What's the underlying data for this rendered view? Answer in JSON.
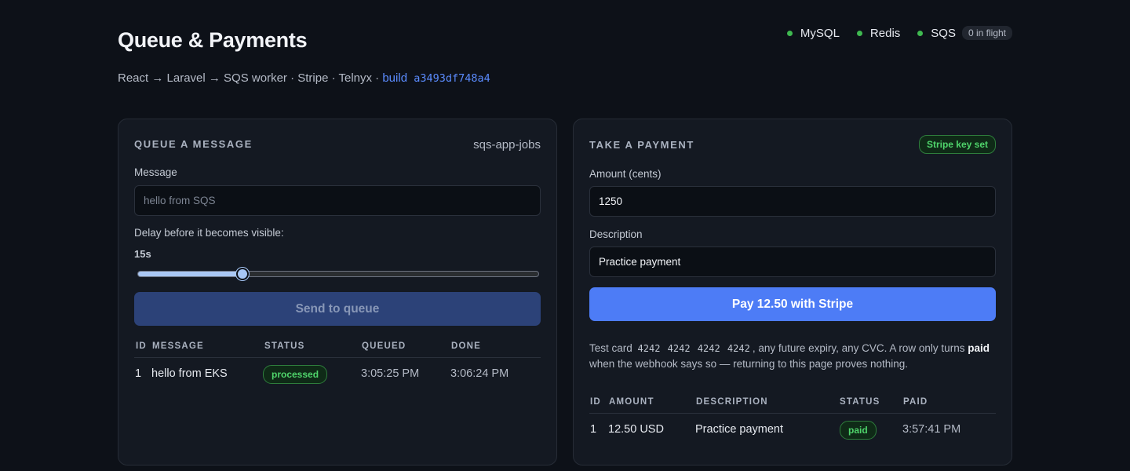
{
  "header": {
    "title": "Queue & Payments",
    "subtitle": "React → Laravel → SQS worker · Stripe · Telnyx ·",
    "build_label": "build",
    "build_hash": "a3493df748a4"
  },
  "services": [
    {
      "name": "MySQL",
      "status_color": "#3fb950"
    },
    {
      "name": "Redis",
      "status_color": "#3fb950"
    },
    {
      "name": "SQS",
      "status_color": "#3fb950",
      "badge": "0 in flight"
    }
  ],
  "queue_card": {
    "title": "QUEUE A MESSAGE",
    "queue_name": "sqs-app-jobs",
    "message_label": "Message",
    "message_placeholder": "hello from SQS",
    "delay_label": "Delay before it becomes visible:",
    "delay_value": "15s",
    "delay_fraction": 0.26,
    "send_label": "Send to queue",
    "columns": [
      "ID",
      "MESSAGE",
      "STATUS",
      "QUEUED",
      "DONE"
    ],
    "rows": [
      {
        "id": "1",
        "message": "hello from EKS",
        "status": "processed",
        "queued": "3:05:25 PM",
        "done": "3:06:24 PM"
      }
    ]
  },
  "payment_card": {
    "title": "TAKE A PAYMENT",
    "key_badge": "Stripe key set",
    "amount_label": "Amount (cents)",
    "amount_value": "1250",
    "description_label": "Description",
    "description_value": "Practice payment",
    "pay_label": "Pay 12.50 with Stripe",
    "note_prefix": "Test card",
    "test_card": "4242 4242 4242 4242",
    "note_middle": ", any future expiry, any CVC. A row only turns",
    "note_bold": "paid",
    "note_suffix": "when the webhook says so — returning to this page proves nothing.",
    "columns": [
      "ID",
      "AMOUNT",
      "DESCRIPTION",
      "STATUS",
      "PAID"
    ],
    "rows": [
      {
        "id": "1",
        "amount": "12.50 USD",
        "description": "Practice payment",
        "status": "paid",
        "paid": "3:57:41 PM"
      }
    ]
  },
  "colors": {
    "accent": "#4d7cf6",
    "success": "#3fb950",
    "background": "#0d1118",
    "card": "#141922"
  }
}
